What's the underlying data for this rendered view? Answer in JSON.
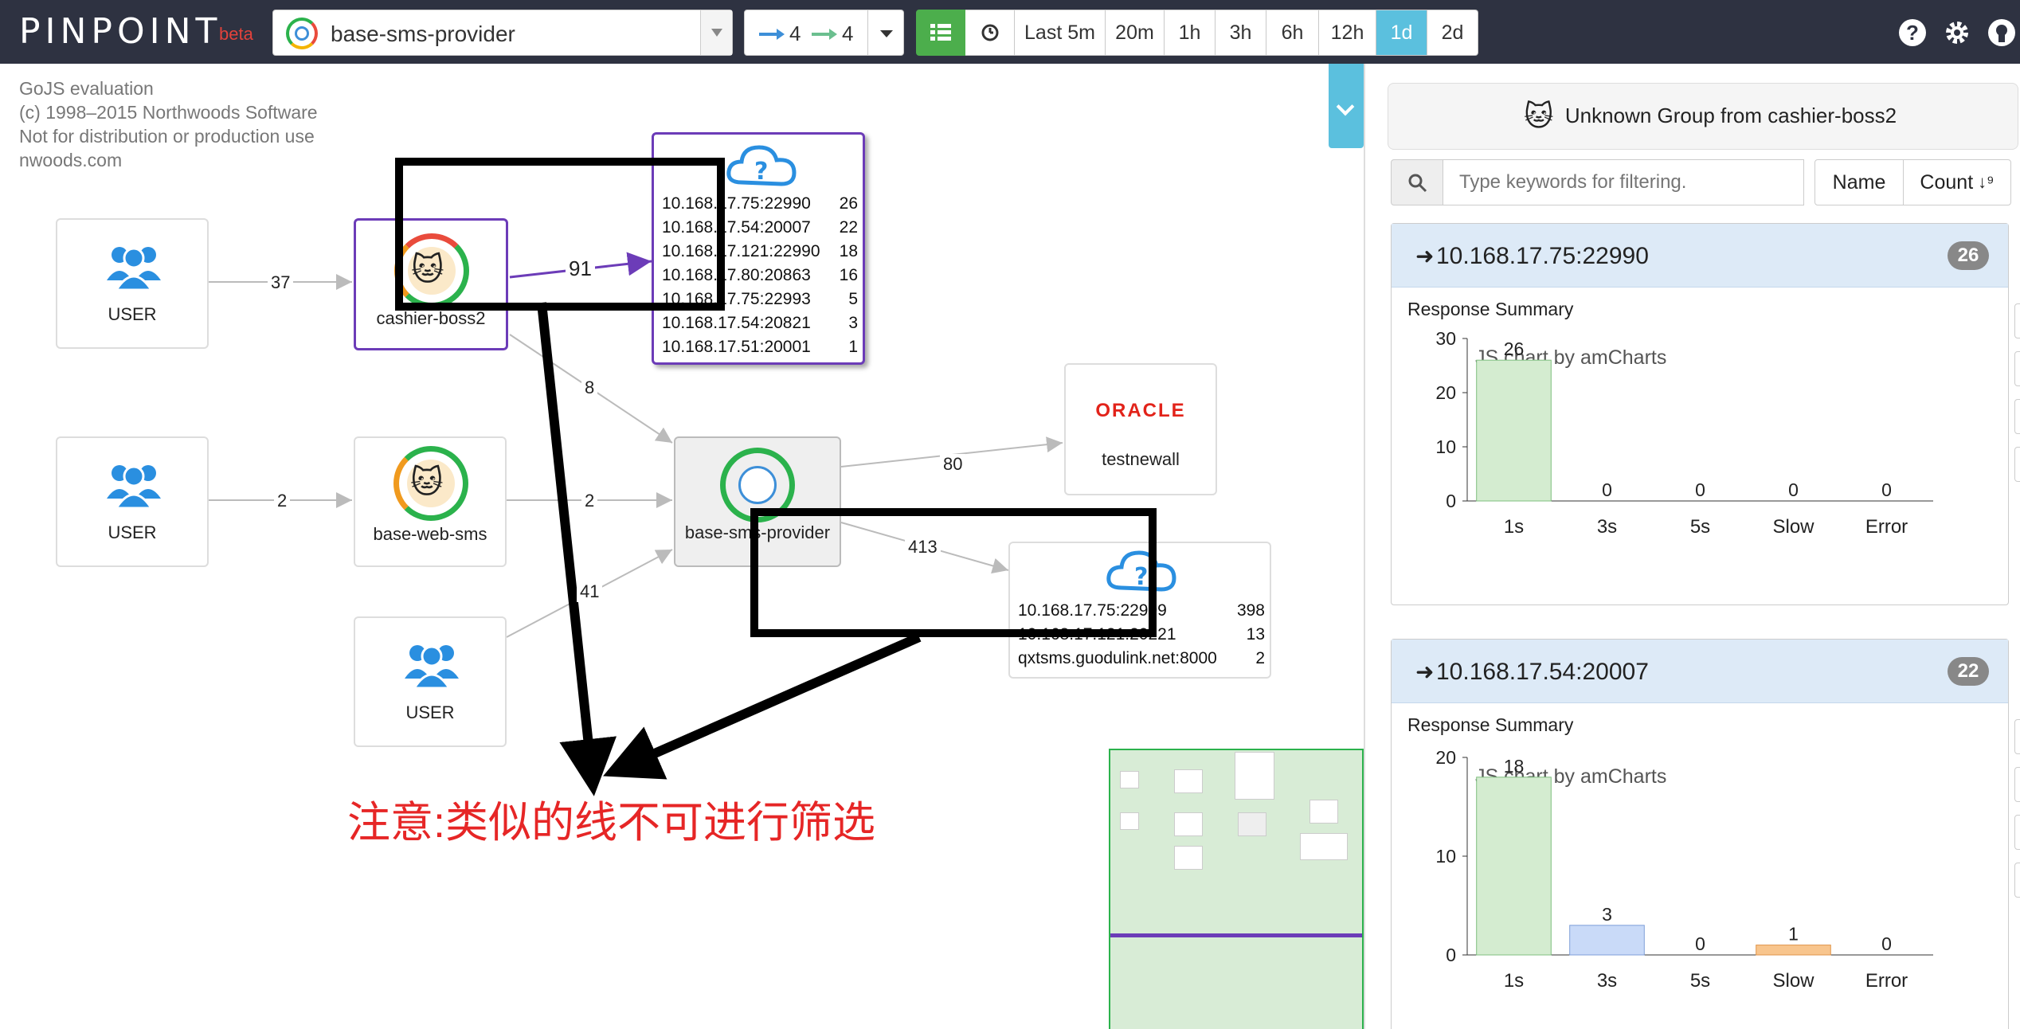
{
  "header": {
    "logo": "PINPOINT",
    "logo_badge": "beta",
    "app_name": "base-sms-provider",
    "inbound_depth": "4",
    "outbound_depth": "4",
    "periods": [
      "Last 5m",
      "20m",
      "1h",
      "3h",
      "6h",
      "12h",
      "1d",
      "2d"
    ],
    "active_period": "1d",
    "help": "?"
  },
  "map": {
    "gojs_note": "GoJS evaluation\n(c) 1998–2015 Northwoods Software\nNot for distribution or production use\nnwoods.com",
    "nodes": {
      "user1": "USER",
      "user2": "USER",
      "user3": "USER",
      "cashier": "cashier-boss2",
      "web_sms": "base-web-sms",
      "provider": "base-sms-provider",
      "oracle_logo": "ORACLE",
      "oracle_name": "testnewall"
    },
    "edges": {
      "user1_cashier": "37",
      "cashier_cloud": "91",
      "cashier_provider": "8",
      "user2_websms": "2",
      "websms_provider": "2",
      "user3_provider": "41",
      "provider_oracle": "80",
      "provider_cloud2": "413"
    },
    "cloud1": [
      {
        "host": "10.168.17.75:22990",
        "count": "26"
      },
      {
        "host": "10.168.17.54:20007",
        "count": "22"
      },
      {
        "host": "10.168.17.121:22990",
        "count": "18"
      },
      {
        "host": "10.168.17.80:20863",
        "count": "16"
      },
      {
        "host": "10.168.17.75:22993",
        "count": "5"
      },
      {
        "host": "10.168.17.54:20821",
        "count": "3"
      },
      {
        "host": "10.168.17.51:20001",
        "count": "1"
      }
    ],
    "cloud2": [
      {
        "host": "10.168.17.75:22999",
        "count": "398"
      },
      {
        "host": "10.168.17.121:20221",
        "count": "13"
      },
      {
        "host": "qxtsms.guodulink.net:8000",
        "count": "2"
      }
    ],
    "annotation": "注意:类似的线不可进行筛选"
  },
  "panel": {
    "header_title": "Unknown Group from cashier-boss2",
    "filter_placeholder": "Type keywords for filtering.",
    "sort_name": "Name",
    "sort_count": "Count",
    "cards": [
      {
        "host": "10.168.17.75:22990",
        "badge": "26",
        "summary_label": "Response Summary",
        "watermark": "JS chart by amCharts"
      },
      {
        "host": "10.168.17.54:20007",
        "badge": "22",
        "summary_label": "Response Summary",
        "watermark": "JS chart by amCharts"
      }
    ]
  },
  "colors": {
    "topbar": "#2e3241",
    "active_period": "#5bc0de",
    "annotation": "#e62626",
    "bar_1s": "#d4ecd0",
    "bar_3s": "#c9daf8",
    "bar_slow": "#f8c58d",
    "card_head": "#ddeaf7"
  },
  "chart_data": [
    {
      "type": "bar",
      "title": "Response Summary",
      "categories": [
        "1s",
        "3s",
        "5s",
        "Slow",
        "Error"
      ],
      "values": [
        26,
        0,
        0,
        0,
        0
      ],
      "ylim": [
        0,
        30
      ],
      "yticks": [
        0,
        10,
        20,
        30
      ],
      "grid": false,
      "legend": "none"
    },
    {
      "type": "bar",
      "title": "Response Summary",
      "categories": [
        "1s",
        "3s",
        "5s",
        "Slow",
        "Error"
      ],
      "values": [
        18,
        3,
        0,
        1,
        0
      ],
      "ylim": [
        0,
        20
      ],
      "yticks": [
        0,
        10,
        20
      ],
      "grid": false,
      "legend": "none"
    }
  ]
}
